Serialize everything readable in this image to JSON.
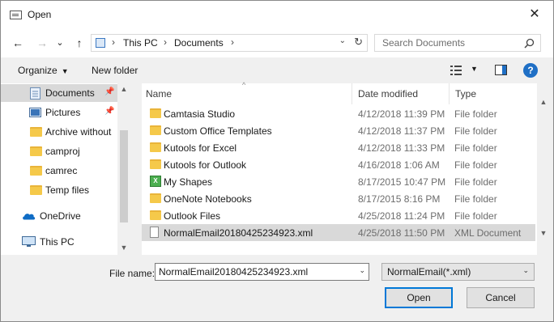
{
  "window": {
    "title": "Open",
    "close_glyph": "✕"
  },
  "nav": {
    "back_glyph": "←",
    "forward_glyph": "→",
    "recent_glyph": "⌄",
    "up_glyph": "↑",
    "breadcrumb": [
      "This PC",
      "Documents"
    ],
    "chevron": "›",
    "refresh_glyph": "↻",
    "search_placeholder": "Search Documents"
  },
  "toolbar": {
    "organize_label": "Organize",
    "new_folder_label": "New folder",
    "help_label": "?",
    "caret": "▼"
  },
  "sidebar": {
    "items": [
      {
        "label": "Documents",
        "icon": "documents-icon",
        "pinned": true
      },
      {
        "label": "Pictures",
        "icon": "pictures-icon",
        "pinned": true
      },
      {
        "label": "Archive without",
        "icon": "folder-icon",
        "pinned": false
      },
      {
        "label": "camproj",
        "icon": "folder-icon",
        "pinned": false
      },
      {
        "label": "camrec",
        "icon": "folder-icon",
        "pinned": false
      },
      {
        "label": "Temp files",
        "icon": "folder-icon",
        "pinned": false
      },
      {
        "label": "OneDrive",
        "icon": "onedrive-icon",
        "pinned": false
      },
      {
        "label": "This PC",
        "icon": "this-pc-icon",
        "pinned": false
      }
    ],
    "pin_glyph": "📌"
  },
  "files": {
    "columns": {
      "name": "Name",
      "date": "Date modified",
      "type": "Type"
    },
    "sort_glyph": "^",
    "rows": [
      {
        "name": "Camtasia Studio",
        "date": "4/12/2018 11:39 PM",
        "type": "File folder",
        "icon": "folder-icon"
      },
      {
        "name": "Custom Office Templates",
        "date": "4/12/2018 11:37 PM",
        "type": "File folder",
        "icon": "folder-icon"
      },
      {
        "name": "Kutools for Excel",
        "date": "4/12/2018 11:33 PM",
        "type": "File folder",
        "icon": "folder-icon"
      },
      {
        "name": "Kutools for Outlook",
        "date": "4/16/2018 1:06 AM",
        "type": "File folder",
        "icon": "folder-icon"
      },
      {
        "name": "My Shapes",
        "date": "8/17/2015 10:47 PM",
        "type": "File folder",
        "icon": "shapes-folder-icon"
      },
      {
        "name": "OneNote Notebooks",
        "date": "8/17/2015 8:16 PM",
        "type": "File folder",
        "icon": "folder-icon"
      },
      {
        "name": "Outlook Files",
        "date": "4/25/2018 11:24 PM",
        "type": "File folder",
        "icon": "folder-icon"
      },
      {
        "name": "NormalEmail20180425234923.xml",
        "date": "4/25/2018 11:50 PM",
        "type": "XML Document",
        "icon": "document-icon"
      }
    ]
  },
  "footer": {
    "file_name_label": "File name:",
    "file_name_value": "NormalEmail20180425234923.xml",
    "file_type_value": "NormalEmail(*.xml)",
    "open_label": "Open",
    "cancel_label": "Cancel",
    "dropdown_glyph": "⌄"
  }
}
